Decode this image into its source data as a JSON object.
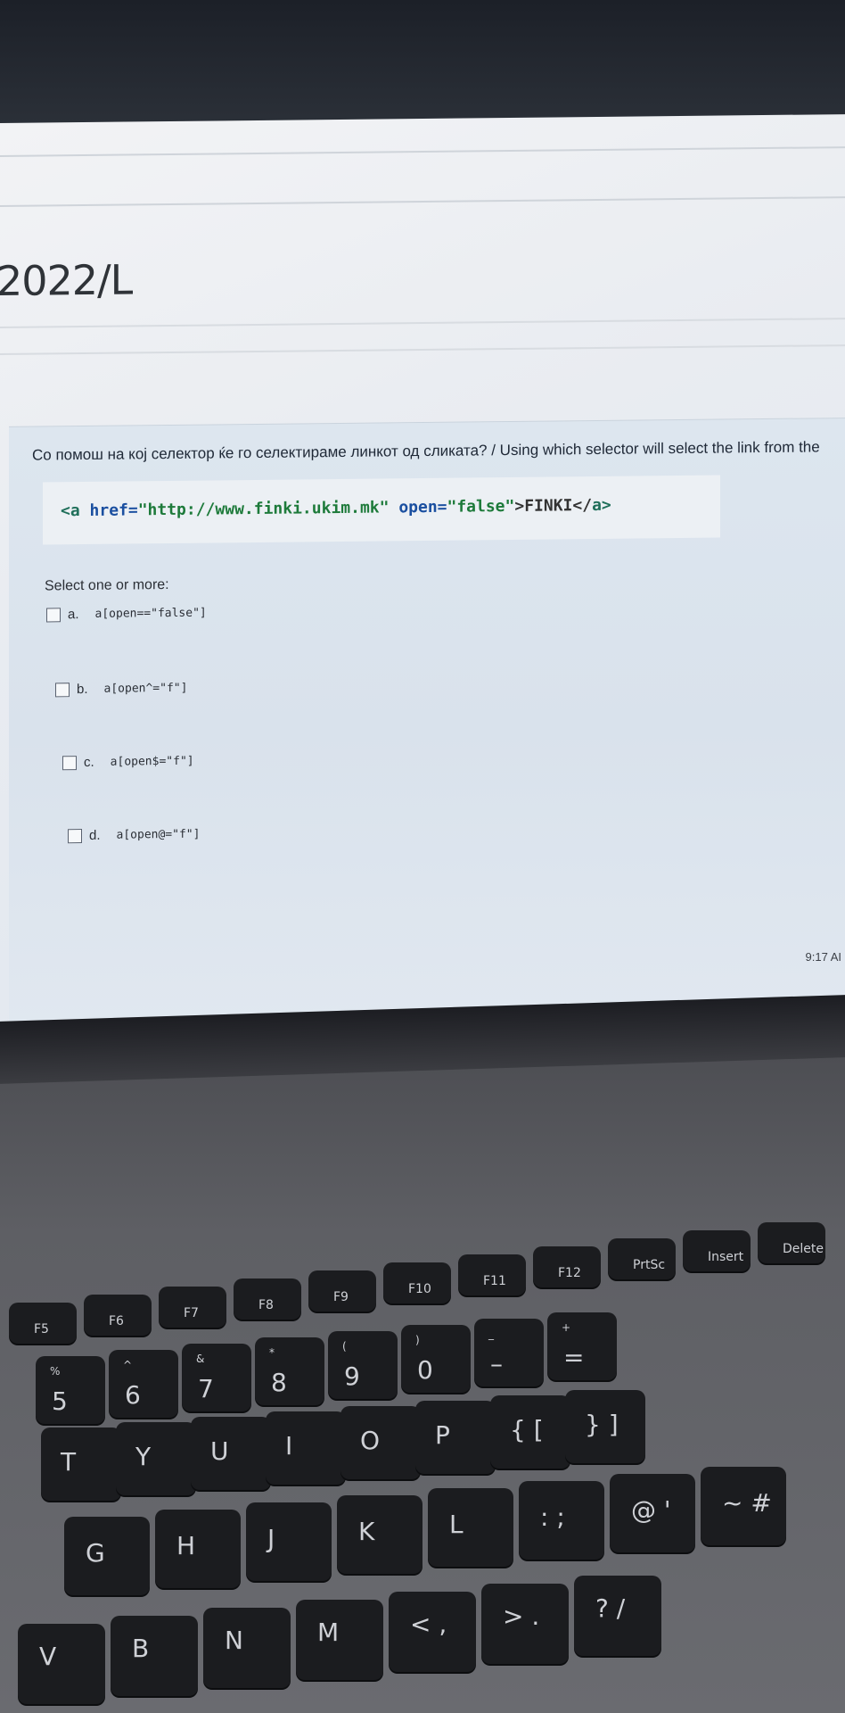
{
  "course": {
    "title": "2022/L"
  },
  "question": {
    "text": "Со помош на кој селектор ќе го селектираме линкот од сликата? / Using which selector will select the link from the",
    "code": {
      "open_tag": "<a ",
      "href_attr": "href=",
      "href_value": "\"http://www.finki.ukim.mk\"",
      "open_attr": "open=",
      "open_value": "\"false\"",
      "link_text": ">FINKI</",
      "close_tag": "a>"
    },
    "prompt": "Select one or more:",
    "options": [
      {
        "letter": "a.",
        "selector": "a[open==\"false\"]"
      },
      {
        "letter": "b.",
        "selector": "a[open^=\"f\"]"
      },
      {
        "letter": "c.",
        "selector": "a[open$=\"f\"]"
      },
      {
        "letter": "d.",
        "selector": "a[open@=\"f\"]"
      }
    ]
  },
  "taskbar": {
    "clock": "9:17 AI"
  },
  "keyboard": {
    "fkeys": [
      "F5",
      "F6",
      "F7",
      "F8",
      "F9",
      "F10",
      "F11",
      "F12",
      "PrtSc",
      "Insert",
      "Delete"
    ],
    "row_num": [
      {
        "top": "%",
        "bottom": "5"
      },
      {
        "top": "^",
        "bottom": "6"
      },
      {
        "top": "&",
        "bottom": "7"
      },
      {
        "top": "*",
        "bottom": "8"
      },
      {
        "top": "(",
        "bottom": "9"
      },
      {
        "top": ")",
        "bottom": "0"
      },
      {
        "top": "_",
        "bottom": "–"
      },
      {
        "top": "+",
        "bottom": "="
      }
    ],
    "row_q": [
      "T",
      "Y",
      "U",
      "I",
      "O",
      "P",
      "{ [",
      "} ]"
    ],
    "row_a": [
      "G",
      "H",
      "J",
      "K",
      "L",
      ": ;",
      "@ '",
      "~ #"
    ],
    "row_z": [
      "V",
      "B",
      "N",
      "M",
      "< ,",
      "> .",
      "? /"
    ]
  }
}
